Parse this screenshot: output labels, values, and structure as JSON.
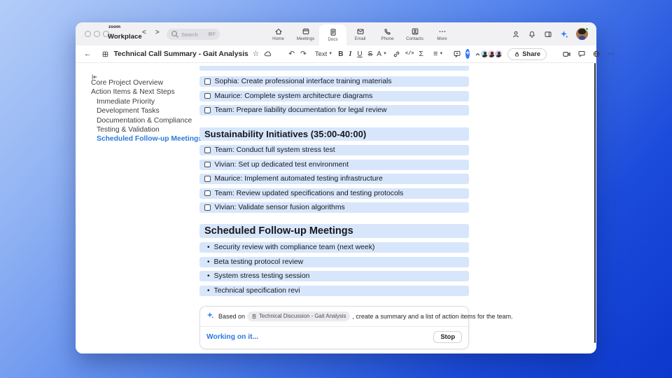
{
  "topbar": {
    "logo_small": "zoom",
    "logo_big": "Workplace",
    "search": {
      "placeholder": "Search",
      "shortcut": "⌘F"
    },
    "nav": [
      {
        "label": "Home",
        "icon": "home",
        "active": false
      },
      {
        "label": "Meetings",
        "icon": "meetings",
        "active": false
      },
      {
        "label": "Docs",
        "icon": "docs",
        "active": true
      },
      {
        "label": "Email",
        "icon": "email",
        "active": false
      },
      {
        "label": "Phone",
        "icon": "phone",
        "active": false
      },
      {
        "label": "Contacts",
        "icon": "contacts",
        "active": false
      },
      {
        "label": "More",
        "icon": "more",
        "active": false
      }
    ]
  },
  "doc_toolbar": {
    "title": "Technical Call Summary - Gait Analysis",
    "text_style": "Text",
    "share": "Share",
    "glyphs": {
      "back": "←",
      "undo": "↶",
      "redo": "↷",
      "star": "☆",
      "bold": "B",
      "italic": "I",
      "underline": "U",
      "strike": "S",
      "color": "A",
      "formula": "Σ",
      "list": "≡",
      "code": "</>",
      "more": "⋯"
    }
  },
  "sidebar": {
    "items": [
      {
        "label": "Core Project Overview",
        "level": 0,
        "active": false
      },
      {
        "label": "Action Items & Next Steps",
        "level": 0,
        "active": false
      },
      {
        "label": "Immediate Priority",
        "level": 1,
        "active": false
      },
      {
        "label": "Development Tasks",
        "level": 1,
        "active": false
      },
      {
        "label": "Documentation & Compliance",
        "level": 1,
        "active": false
      },
      {
        "label": "Testing & Validation",
        "level": 1,
        "active": false
      },
      {
        "label": "Scheduled Follow-up Meetings",
        "level": 1,
        "active": true
      }
    ]
  },
  "document": {
    "blocks": [
      {
        "t": "partial",
        "text": ""
      },
      {
        "t": "check",
        "text": "Sophia: Create professional interface training materials"
      },
      {
        "t": "check",
        "text": "Maurice: Complete system architecture diagrams"
      },
      {
        "t": "check",
        "text": "Team: Prepare liability documentation for legal review"
      },
      {
        "t": "h1",
        "text": "Sustainability Initiatives (35:00-40:00)"
      },
      {
        "t": "check",
        "text": "Team: Conduct full system stress test"
      },
      {
        "t": "check",
        "text": "Vivian: Set up dedicated test environment"
      },
      {
        "t": "check",
        "text": "Maurice: Implement automated testing infrastructure"
      },
      {
        "t": "check",
        "text": "Team: Review updated specifications and testing protocols"
      },
      {
        "t": "check",
        "text": "Vivian: Validate sensor fusion algorithms"
      },
      {
        "t": "h2",
        "text": "Scheduled Follow-up Meetings"
      },
      {
        "t": "bullet",
        "text": "Security review with compliance team (next week)"
      },
      {
        "t": "bullet",
        "text": "Beta testing protocol review"
      },
      {
        "t": "bullet",
        "text": "System stress testing session"
      },
      {
        "t": "bullet",
        "text": "Technical specification revi"
      }
    ]
  },
  "ai_panel": {
    "prefix": "Based on",
    "chip": "Technical Discussion - Gait Analysis",
    "suffix": ", create a summary and a list of action items for the team.",
    "status": "Working on it...",
    "stop": "Stop"
  },
  "colors": {
    "accent": "#2e7af7",
    "highlight": "#d7e6fb",
    "status_blue": "#2878e8",
    "sidebar_active": "#2b7bd9",
    "collaborators": [
      "#bcdcf5",
      "#f3c6cd",
      "#d7c5f2"
    ]
  }
}
